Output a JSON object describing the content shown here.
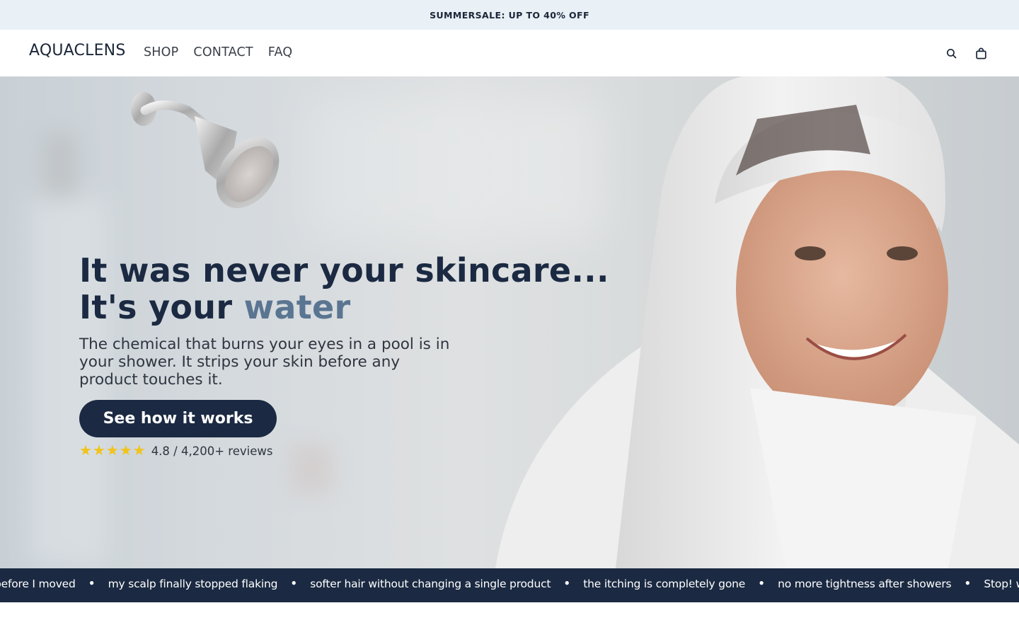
{
  "announcement": {
    "text": "SUMMERSALE: UP TO 40% OFF"
  },
  "header": {
    "logo": "AQUACLENS",
    "nav": [
      "SHOP",
      "CONTACT",
      "FAQ"
    ]
  },
  "hero": {
    "headline_line1": "It was never your skincare...",
    "headline_line2_prefix": "It's your ",
    "headline_line2_accent": "water",
    "subtext": "The chemical that burns your eyes in a pool is in your shower. It strips your skin before any product touches it.",
    "cta_label": "See how it works",
    "rating": {
      "stars": 5,
      "text": "4.8 / 4,200+ reviews"
    }
  },
  "marquee": {
    "items": [
      "before I moved",
      "my scalp finally stopped flaking",
      "softer hair without changing a single product",
      "the itching is completely gone",
      "no more tightness after showers",
      "Stop! wasting money on p"
    ]
  },
  "colors": {
    "navy": "#1b2a42",
    "accent": "#5a7591",
    "announcement_bg": "#e9f0f6",
    "star": "#f2c318"
  },
  "icons": [
    "search-icon",
    "cart-icon",
    "star-icon",
    "shower-head-icon"
  ]
}
